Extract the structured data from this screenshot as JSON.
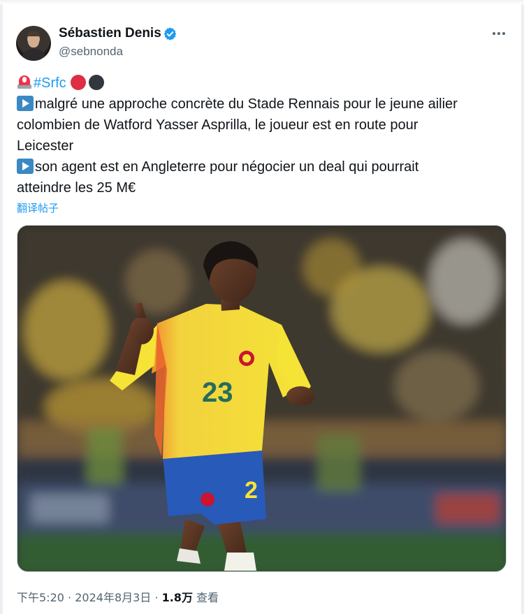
{
  "author": {
    "display_name": "Sébastien Denis",
    "handle": "@sebnonda",
    "verified": true,
    "avatar_icon": "profile-photo"
  },
  "more_icon": "ellipsis-icon",
  "tweet": {
    "hashtag": "#Srfc",
    "line1": "malgré une approche concrète du Stade Rennais pour le jeune ailier",
    "line2": "colombien de Watford Yasser Asprilla, le joueur est en route pour",
    "line3": "Leicester",
    "line4": "son agent est en Angleterre pour négocier un deal qui pourrait",
    "line5": "atteindre les 25 M€",
    "emoji": [
      "police-siren",
      "red-circle",
      "black-circle",
      "play-button",
      "play-button"
    ]
  },
  "translate_label": "翻译帖子",
  "media": {
    "jersey_number": "23",
    "shorts_number": "2"
  },
  "meta": {
    "time": "下午5:20",
    "separator": "·",
    "date": "2024年8月3日",
    "views": "1.8万",
    "views_label": "查看"
  },
  "colors": {
    "link": "#1d9bf0",
    "verified": "#1d9bf0",
    "secondary_text": "#536471",
    "jersey": "#f5e332",
    "shorts": "#2457b8"
  }
}
